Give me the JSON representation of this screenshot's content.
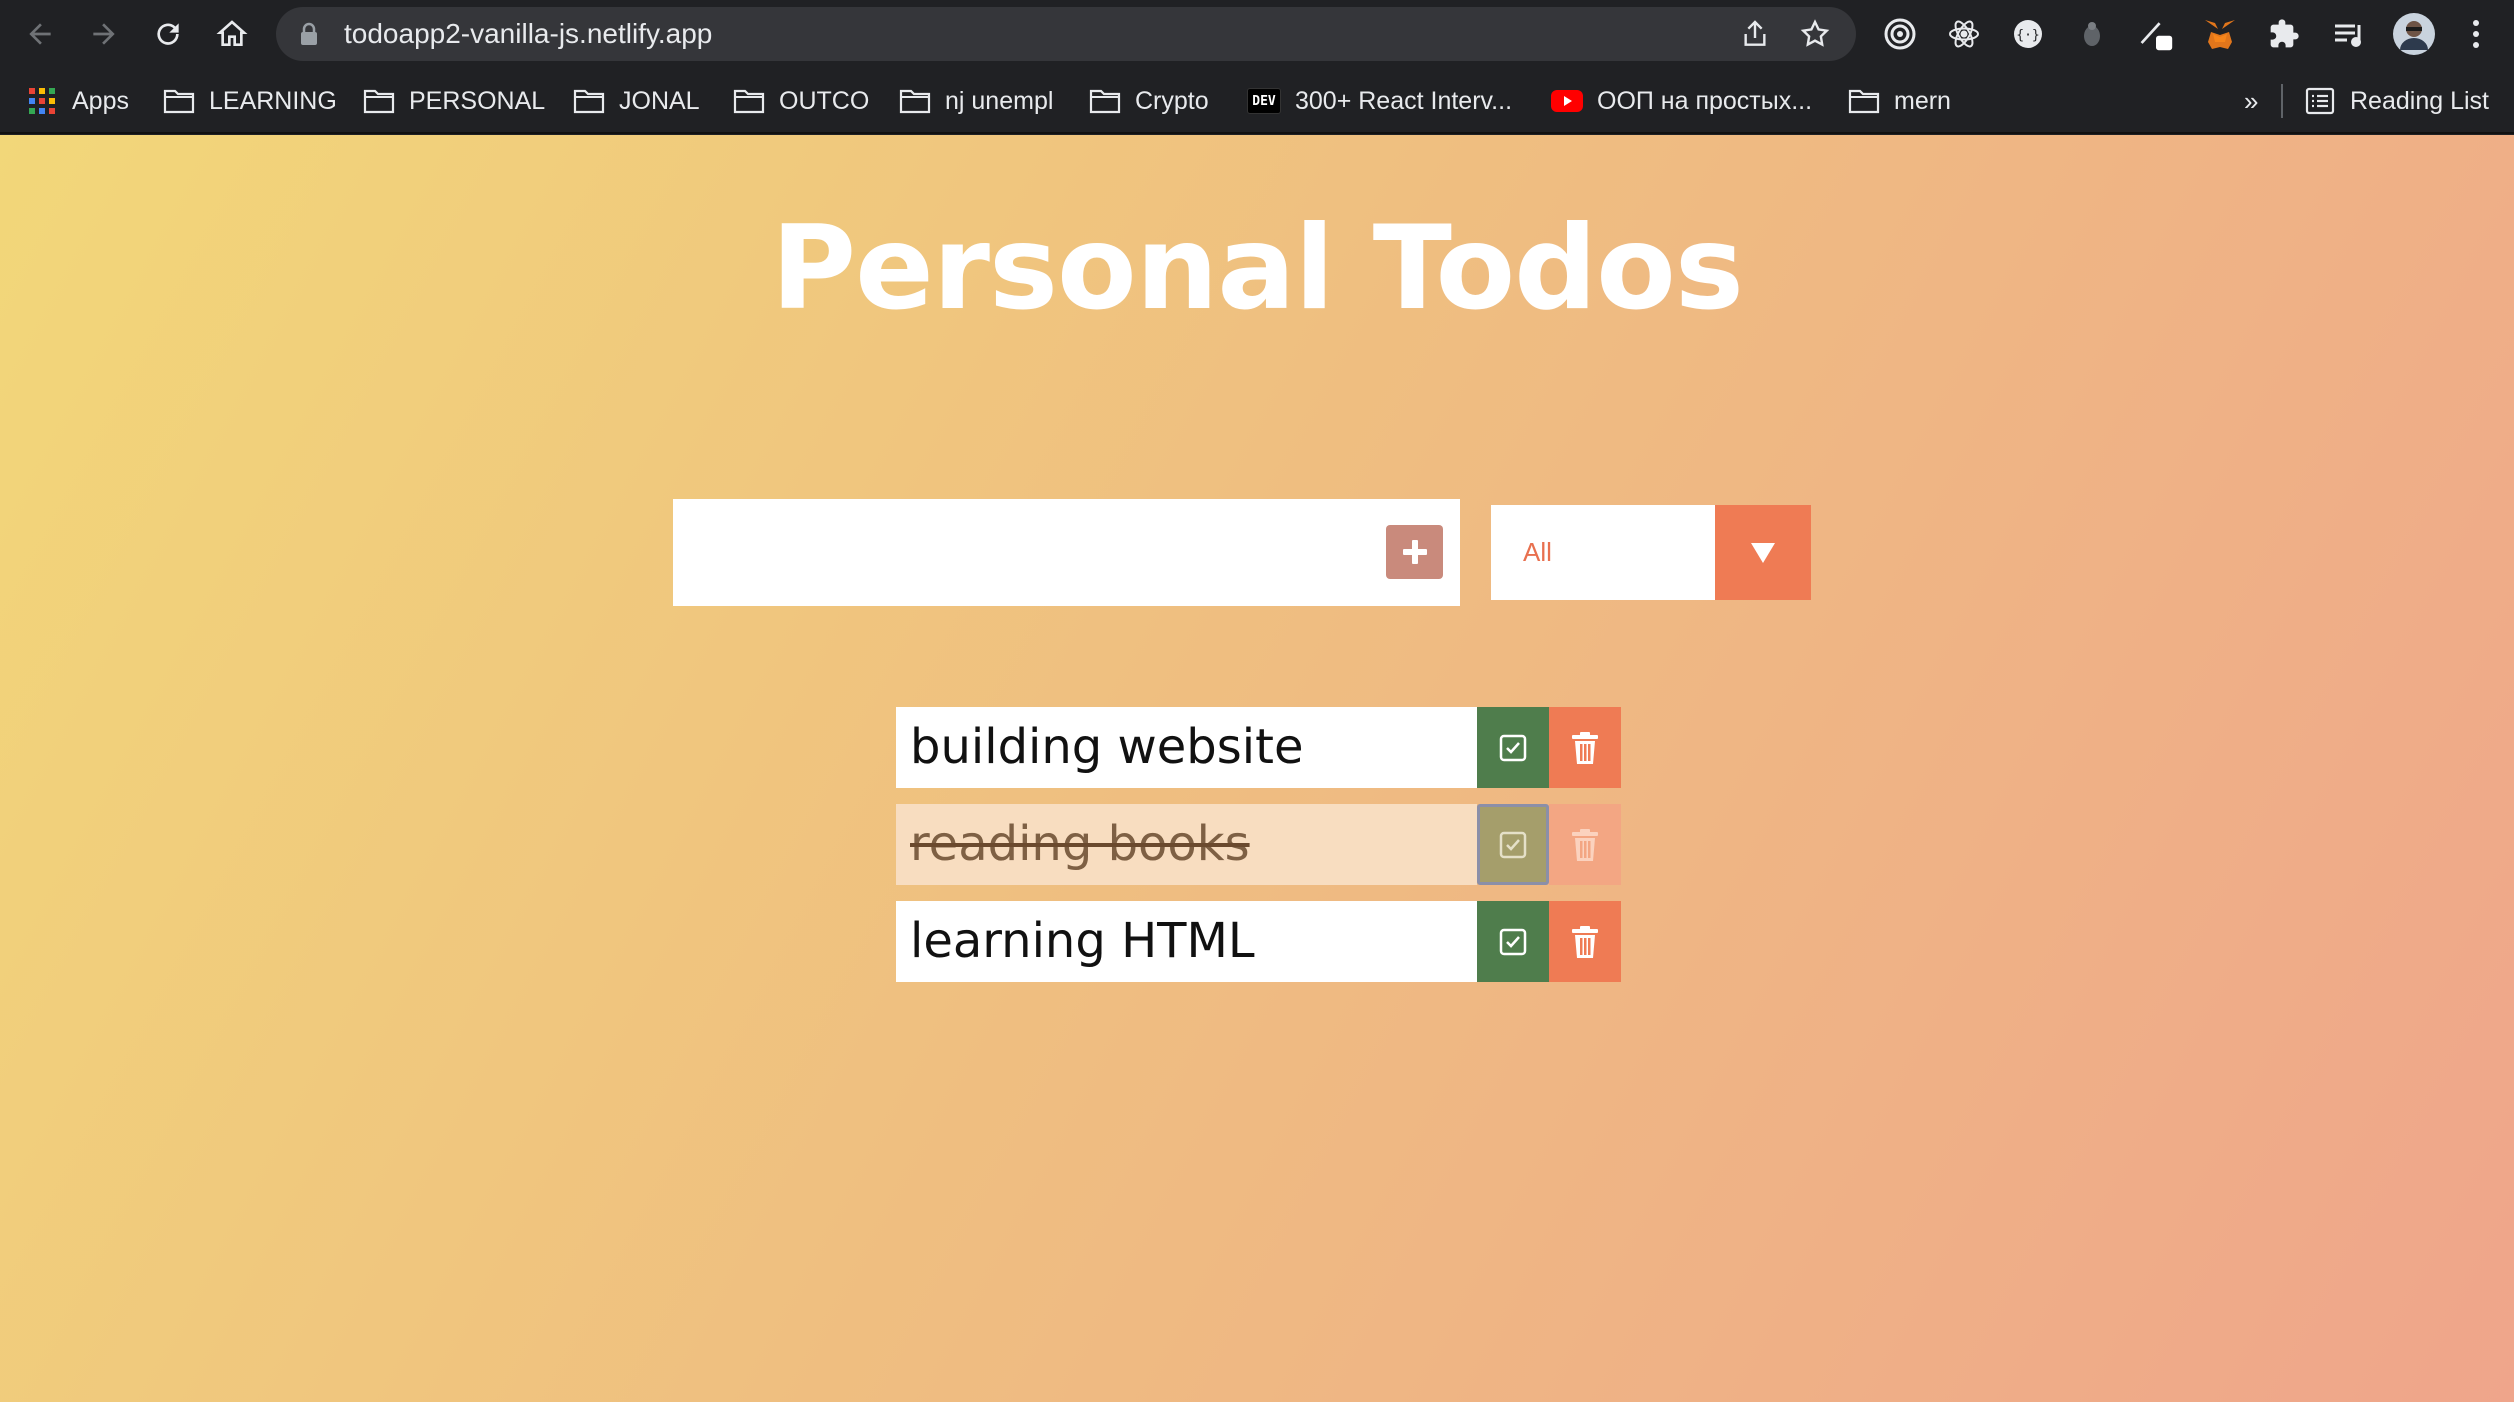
{
  "browser": {
    "url": "todoapp2-vanilla-js.netlify.app",
    "bookmarks": [
      {
        "label": "Apps",
        "icon": "apps-grid-icon"
      },
      {
        "label": "LEARNING",
        "icon": "folder-icon"
      },
      {
        "label": "PERSONAL",
        "icon": "folder-icon"
      },
      {
        "label": "JONAL",
        "icon": "folder-icon"
      },
      {
        "label": "OUTCO",
        "icon": "folder-icon"
      },
      {
        "label": "nj unempl",
        "icon": "folder-icon"
      },
      {
        "label": "Crypto",
        "icon": "folder-icon"
      },
      {
        "label": "300+ React Interv...",
        "icon": "dev-logo-icon",
        "icon_text": "DEV"
      },
      {
        "label": "ООП на простых...",
        "icon": "youtube-icon"
      },
      {
        "label": "mern",
        "icon": "folder-icon"
      }
    ],
    "overflow_label": "»",
    "reading_list_label": "Reading List"
  },
  "app": {
    "title": "Personal Todos",
    "input": {
      "value": "",
      "placeholder": ""
    },
    "filter": {
      "selected": "All"
    },
    "todos": [
      {
        "text": "building website",
        "completed": false
      },
      {
        "text": "reading books",
        "completed": true
      },
      {
        "text": "learning HTML",
        "completed": false
      }
    ]
  },
  "colors": {
    "gradient_start": "#f2d779",
    "gradient_end": "#efa58b",
    "complete_green": "#4f7d4c",
    "trash_orange": "#ef7b54",
    "add_button": "#c98a7c"
  }
}
